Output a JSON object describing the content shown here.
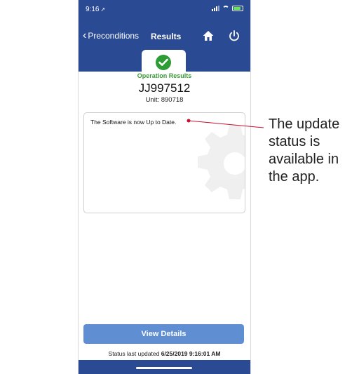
{
  "status_bar": {
    "time": "9:16",
    "location_glyph": "➚"
  },
  "nav": {
    "back_label": "Preconditions",
    "title": "Results"
  },
  "result": {
    "label": "Operation Results",
    "serial": "JJ997512",
    "unit_text": "Unit: 890718",
    "message": "The Software is now Up to Date."
  },
  "actions": {
    "view_details_label": "View Details"
  },
  "status": {
    "updated_prefix": "Status last updated",
    "updated_value": "6/25/2019 9:16:01 AM"
  },
  "annotation": {
    "text": "The update status is available in the app."
  },
  "colors": {
    "nav_blue": "#2b4a94",
    "button_blue": "#5f8ed2",
    "success_green": "#2e9c34",
    "callout_red": "#c8102e"
  },
  "icons": [
    "chevron-left-icon",
    "home-icon",
    "power-icon",
    "checkmark-icon",
    "gear-icon",
    "signal-icon",
    "wifi-icon",
    "battery-icon"
  ]
}
